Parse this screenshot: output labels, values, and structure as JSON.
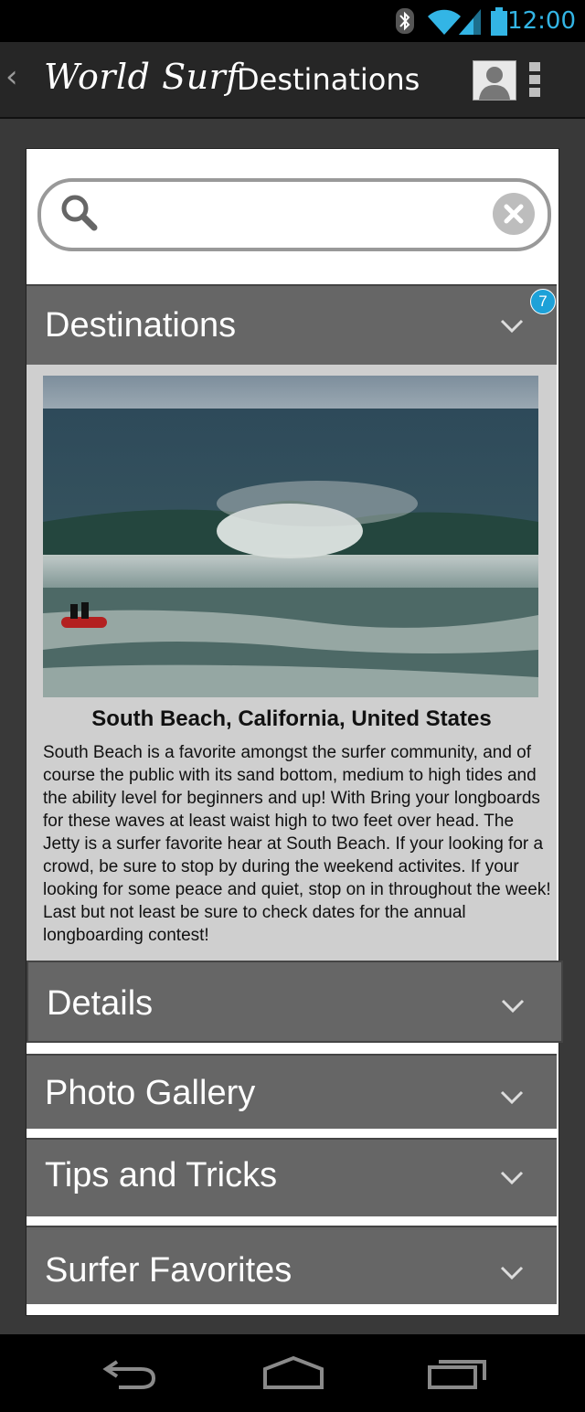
{
  "status_bar": {
    "time": "12:00",
    "icons": [
      "bluetooth-icon",
      "wifi-icon",
      "signal-icon",
      "battery-icon"
    ]
  },
  "action_bar": {
    "back_icon": "back-chevron-icon",
    "app_title": "World Surf",
    "screen_title": "Destinations",
    "icons": [
      "user-avatar-icon",
      "overflow-menu-icon"
    ]
  },
  "search": {
    "value": "",
    "placeholder": "",
    "icons": [
      "search-icon",
      "clear-icon"
    ]
  },
  "sections": {
    "destinations": {
      "label": "Destinations",
      "badge": "7"
    },
    "details": {
      "label": "Details"
    },
    "photo_gallery": {
      "label": "Photo Gallery"
    },
    "tips": {
      "label": "Tips and Tricks"
    },
    "favorites": {
      "label": "Surfer Favorites"
    }
  },
  "destination": {
    "caption": "South Beach, California, United States",
    "description": "South Beach is a favorite amongst the surfer community, and of course the public with its sand bottom, medium to high tides and the ability level for beginners and up! With Bring your longboards for these waves at least waist high to two feet over head. The Jetty is a surfer favorite hear at South Beach. If your looking for a crowd, be sure to stop by during the weekend activites. If your looking for some peace and quiet, stop on in throughout the week! Last but not least be sure to check dates for the annual longboarding contest!"
  },
  "nav_bar": {
    "icons": [
      "back-nav-icon",
      "home-nav-icon",
      "recent-apps-icon"
    ]
  },
  "colors": {
    "accent": "#33b5e5",
    "header_bg": "#666666",
    "badge": "#1da1d8"
  }
}
